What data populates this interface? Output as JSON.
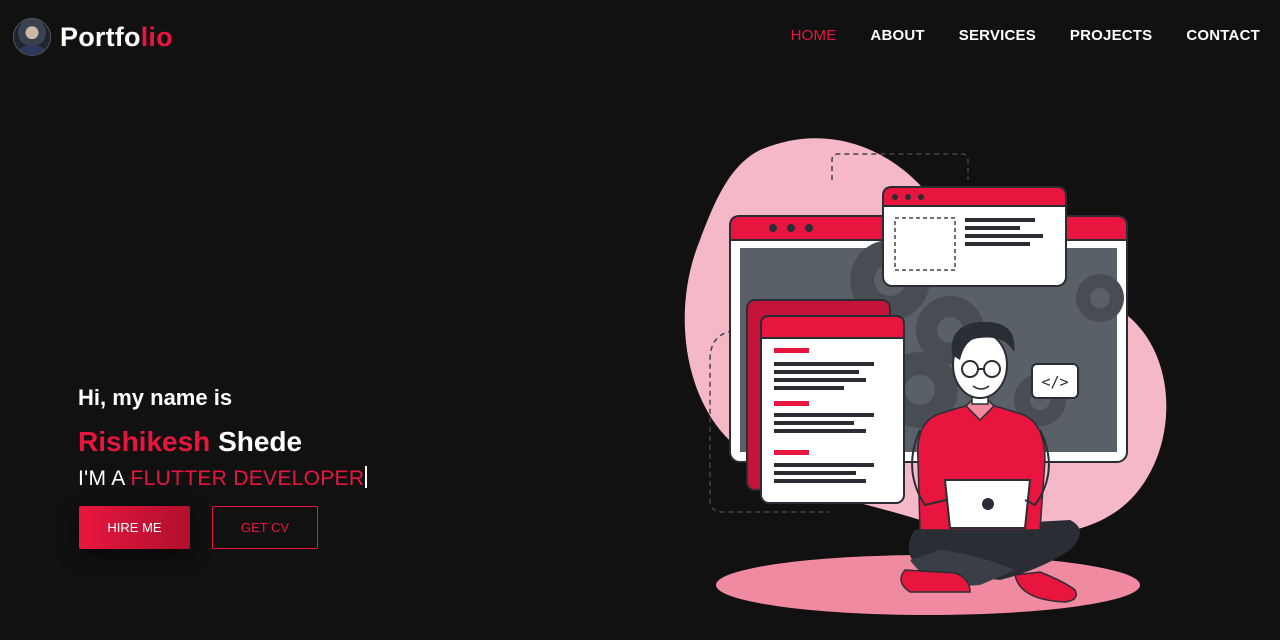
{
  "nav": {
    "brand_part1": "Portfo",
    "brand_part2": "lio",
    "items": [
      {
        "label": "HOME",
        "active": true
      },
      {
        "label": "ABOUT",
        "active": false
      },
      {
        "label": "SERVICES",
        "active": false
      },
      {
        "label": "PROJECTS",
        "active": false
      },
      {
        "label": "CONTACT",
        "active": false
      }
    ]
  },
  "hero": {
    "greeting": "Hi, my name is",
    "first_name": "Rishikesh",
    "last_name": "Shede",
    "role_prefix": "I'M A",
    "role_highlight": "FLUTTER DEVELOPER",
    "hire_button": "HIRE ME",
    "cv_button": "GET CV"
  },
  "colors": {
    "accent": "#e8163f",
    "background": "#111112",
    "blob": "#f4b8c6"
  },
  "illustration": {
    "code_tag": "</>"
  }
}
